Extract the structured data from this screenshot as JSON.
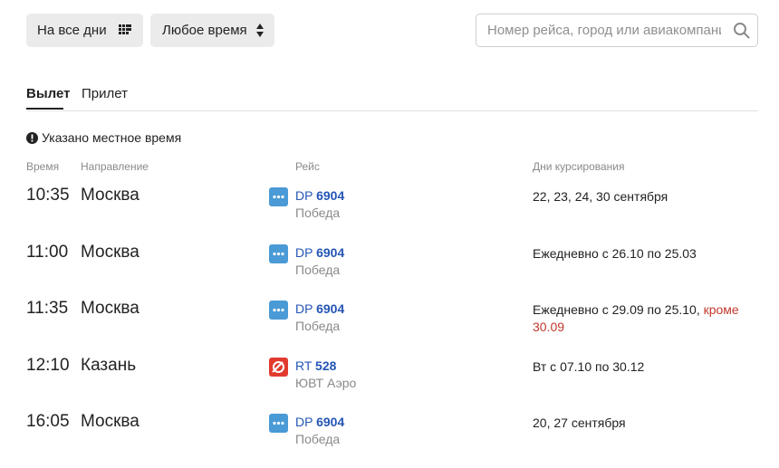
{
  "toolbar": {
    "days_button": "На все дни",
    "time_button": "Любое время",
    "search_placeholder": "Номер рейса, город или авиакомпания"
  },
  "tabs": [
    {
      "label": "Вылет",
      "active": true
    },
    {
      "label": "Прилет",
      "active": false
    }
  ],
  "notice": "Указано местное время",
  "columns": {
    "time": "Время",
    "direction": "Направление",
    "flight": "Рейс",
    "days": "Дни курсирования"
  },
  "flights": [
    {
      "time": "10:35",
      "city": "Москва",
      "prefix": "DP",
      "number": "6904",
      "airline": "Победа",
      "logo": "pobeda-logo",
      "days": "22, 23, 24, 30 сентября",
      "except": ""
    },
    {
      "time": "11:00",
      "city": "Москва",
      "prefix": "DP",
      "number": "6904",
      "airline": "Победа",
      "logo": "pobeda-logo",
      "days": "Ежедневно с 26.10 по 25.03",
      "except": ""
    },
    {
      "time": "11:35",
      "city": "Москва",
      "prefix": "DP",
      "number": "6904",
      "airline": "Победа",
      "logo": "pobeda-logo",
      "days": "Ежедневно с 29.09 по 25.10,",
      "except": "кроме 30.09"
    },
    {
      "time": "12:10",
      "city": "Казань",
      "prefix": "RT",
      "number": "528",
      "airline": "ЮВТ Аэро",
      "logo": "uvt-aero-logo",
      "days": "Вт с 07.10 по 30.12",
      "except": ""
    },
    {
      "time": "16:05",
      "city": "Москва",
      "prefix": "DP",
      "number": "6904",
      "airline": "Победа",
      "logo": "pobeda-logo",
      "days": "20, 27 сентября",
      "except": ""
    }
  ],
  "colors": {
    "link": "#2455b5",
    "muted": "#8a8a8a",
    "exception": "#c0392b",
    "pobeda": "#4a9ad6",
    "uvt_aero": "#e23a2f"
  }
}
